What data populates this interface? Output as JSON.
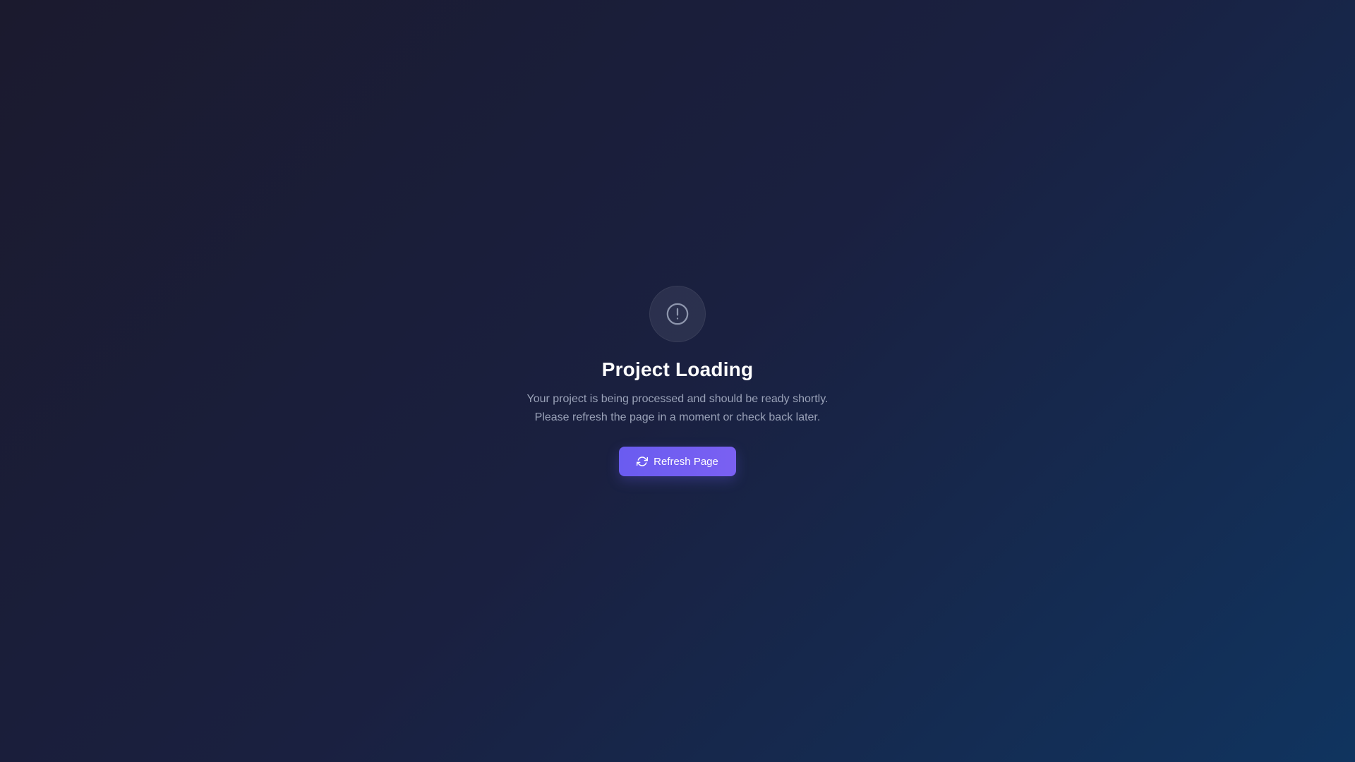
{
  "status": {
    "icon": "alert-circle-icon",
    "title": "Project Loading",
    "description_line1": "Your project is being processed and should be ready shortly.",
    "description_line2": "Please refresh the page in a moment or check back later."
  },
  "action": {
    "refresh_label": "Refresh Page",
    "refresh_icon": "refresh-icon"
  },
  "colors": {
    "background_start": "#1b1a2e",
    "background_end": "#10345f",
    "accent": "#6a5cf0",
    "title_text": "#ffffff",
    "body_text": "#9aa2b8"
  }
}
